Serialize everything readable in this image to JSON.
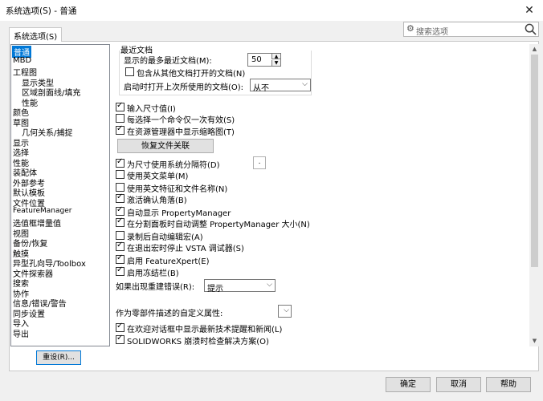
{
  "window": {
    "title": "系统选项(S) - 普通",
    "close": "✕"
  },
  "tab": {
    "label": "系统选项(S)"
  },
  "search": {
    "placeholder": "搜索选项"
  },
  "tree": {
    "items": [
      "普通",
      "MBD",
      "工程图",
      "显示类型",
      "区域剖面线/填充",
      "性能",
      "颜色",
      "草图",
      "几何关系/捕捉",
      "显示",
      "选择",
      "性能",
      "装配体",
      "外部参考",
      "默认模板",
      "文件位置",
      "FeatureManager",
      "选值框增量值",
      "视图",
      "备份/恢复",
      "触摸",
      "异型孔向导/Toolbox",
      "文件探索器",
      "搜索",
      "协作",
      "信息/错误/警告",
      "同步设置",
      "导入",
      "导出"
    ]
  },
  "reset_button": "重设(R)...",
  "recent": {
    "title": "最近文档",
    "max_label": "显示的最多最近文档(M):",
    "max_value": "50",
    "include_label": "包含从其他文档打开的文档(N)",
    "open_last_label": "启动时打开上次所使用的文档(O):",
    "open_last_value": "从不"
  },
  "options": {
    "o1": "输入尺寸值(I)",
    "o2": "每选择一个命令仅一次有效(S)",
    "o3": "在资源管理器中显示缩略图(T)",
    "restore": "恢复文件关联",
    "o4": "为尺寸使用系统分隔符(D)",
    "sep_value": ".",
    "o5": "使用英文菜单(M)",
    "o6": "使用英文特征和文件名称(N)",
    "o7": "激活确认角落(B)",
    "o8": "自动显示 PropertyManager",
    "o9": "在分割面板时自动调整 PropertyManager 大小(N)",
    "o10": "录制后自动编辑宏(A)",
    "o11": "在退出宏时停止 VSTA 调试器(S)",
    "o12": "启用 FeatureXpert(E)",
    "o13": "启用冻结栏(B)",
    "rebuild_label": "如果出现重建错误(R):",
    "rebuild_value": "提示",
    "custom_label": "作为零部件描述的自定义属性:",
    "custom_value": "",
    "o14": "在欢迎对话框中显示最新技术提醒和新闻(L)",
    "o15": "SOLIDWORKS 崩溃时检查解决方案(O)"
  },
  "footer": {
    "ok": "确定",
    "cancel": "取消",
    "help": "帮助"
  }
}
